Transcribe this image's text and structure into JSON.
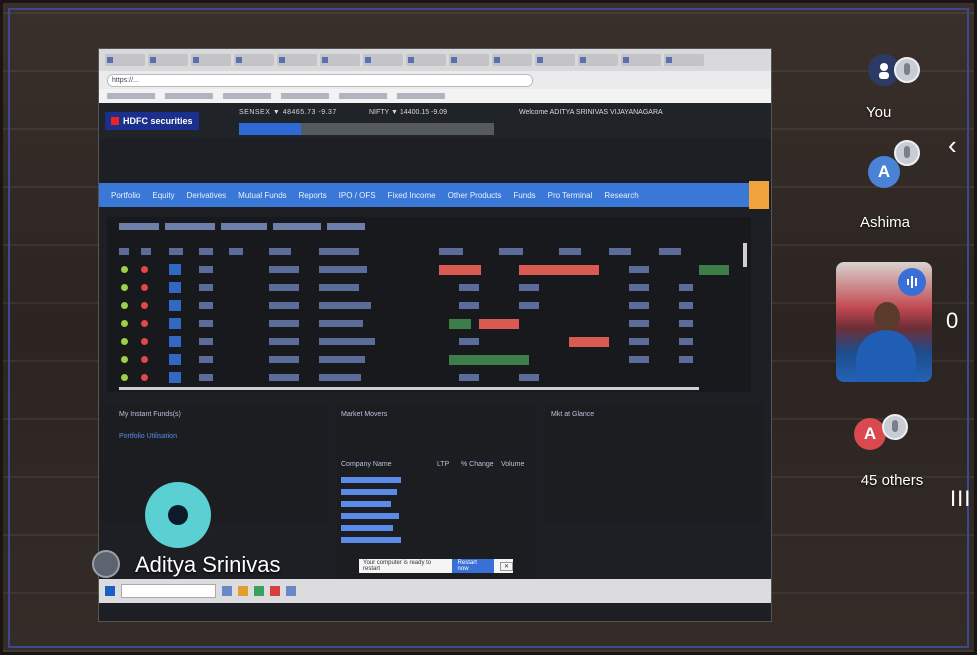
{
  "browser": {
    "url": "https://...",
    "tabs_count": 14
  },
  "trading_site": {
    "logo": "HDFC securities",
    "ticker_1": "SENSEX ▼ 48465.73 -9.37",
    "ticker_2": "NIFTY ▼ 14400.15 -9.09",
    "welcome": "Welcome ADITYA SRINIVAS VIJAYANAGARA",
    "nav": [
      "Portfolio",
      "Equity",
      "Derivatives",
      "Mutual Funds",
      "Reports",
      "IPO / OFS",
      "Fixed Income",
      "Other Products",
      "Funds",
      "Pro Terminal",
      "Research"
    ],
    "lower_left_title": "My Instant Funds(s)",
    "lower_left_link": "Portfolio Utilisation",
    "lower_mid_title": "Market Movers",
    "lower_mid_headers": [
      "Company Name",
      "LTP",
      "% Change",
      "Volume"
    ],
    "lower_right_title": "Mkt at Glance"
  },
  "toast": {
    "text": "Your computer is ready to restart",
    "primary": "Restart now",
    "secondary": "✕"
  },
  "presenter": {
    "name": "Aditya Srinivas"
  },
  "participants": {
    "you_label": "You",
    "ashima_label": "Ashima",
    "ashima_initial": "A",
    "others_initial": "A",
    "others_label": "45 others"
  },
  "controls": {
    "chevron": "‹",
    "zero": "0",
    "bars": "III"
  },
  "colors": {
    "accent_blue": "#3a78d8",
    "presenter_ring": "#5ad0d2",
    "ashima_avatar": "#4a82d6",
    "others_avatar": "#d9494f"
  }
}
